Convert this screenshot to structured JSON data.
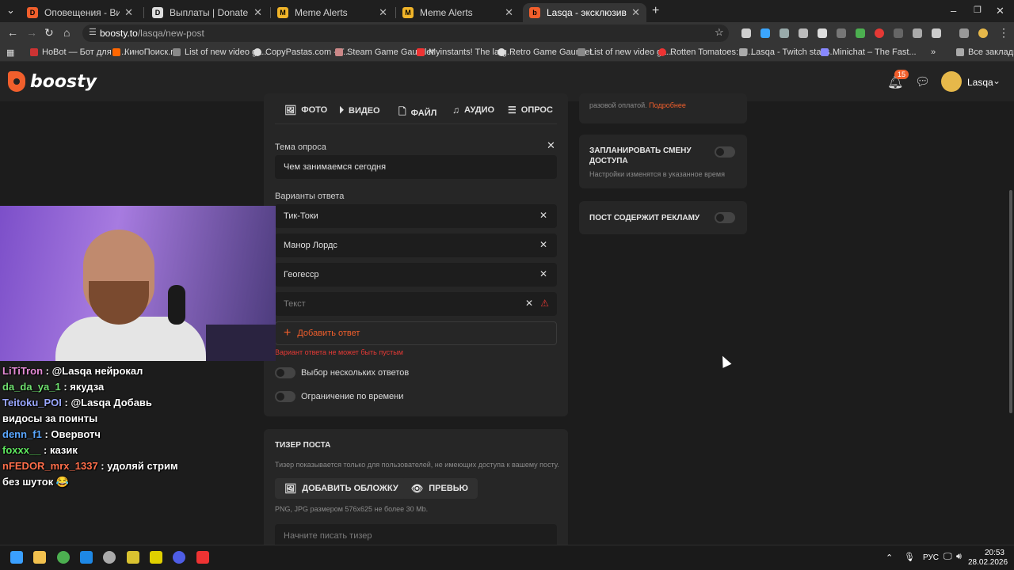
{
  "browser": {
    "tabs": [
      {
        "title": "Оповещения - Виджеты - Dona",
        "icon": "D",
        "color": "#f15f2c"
      },
      {
        "title": "Выплаты | DonatePay",
        "icon": "D",
        "color": "#111111"
      },
      {
        "title": "Meme Alerts",
        "icon": "M",
        "color": "#f0b429"
      },
      {
        "title": "Meme Alerts",
        "icon": "M",
        "color": "#f0b429"
      },
      {
        "title": "Lasqa - эксклюзивный контен",
        "icon": "b",
        "color": "#f15f2c"
      }
    ],
    "url_host": "boosty.to",
    "url_path": "/lasqa/new-post",
    "bookmarks": [
      "HoBot — Бот для V...",
      "КиноПоиск.ru",
      "List of new video ga...",
      "CopyPastas.com - T...",
      "Steam Game Gauntlet",
      "Myinstants! The larg...",
      "Retro Game Gauntlet",
      "List of new video ga...",
      "Rotten Tomatoes: M...",
      "Lasqa - Twitch statis...",
      "Minichat – The Fast..."
    ],
    "all_bookmarks": "Все закладки"
  },
  "site": {
    "logo": "boosty",
    "notifications": "15",
    "user": "Lasqa"
  },
  "editor": {
    "media_tabs": [
      {
        "label": "ФОТО",
        "icon": "image-icon"
      },
      {
        "label": "ВИДЕО",
        "icon": "play-icon"
      },
      {
        "label": "ФАЙЛ",
        "icon": "file-icon"
      },
      {
        "label": "АУДИО",
        "icon": "music-icon"
      },
      {
        "label": "ОПРОС",
        "icon": "list-icon"
      }
    ],
    "poll": {
      "topic_label": "Тема опроса",
      "topic_value": "Чем занимаемся сегодня",
      "answers_label": "Варианты ответа",
      "answers": [
        "Тик-Токи",
        "Манор Лордс",
        "Геогесср"
      ],
      "answer_placeholder": "Текст",
      "add_answer": "Добавить ответ",
      "error": "Вариант ответа не может быть пустым",
      "multiple_label": "Выбор нескольких ответов",
      "time_limit_label": "Ограничение по времени"
    },
    "teaser": {
      "title": "ТИЗЕР ПОСТА",
      "desc": "Тизер показывается только для пользователей, не имеющих доступа к вашему посту.",
      "add_cover": "ДОБАВИТЬ ОБЛОЖКУ",
      "preview": "ПРЕВЬЮ",
      "hint": "PNG, JPG размером 576x625 не более 30 Mb.",
      "placeholder": "Начните писать тизер"
    }
  },
  "sidebar": {
    "top_text": "разовой оплатой.",
    "top_link": "Подробнее",
    "schedule_title": "ЗАПЛАНИРОВАТЬ СМЕНУ ДОСТУПА",
    "schedule_desc": "Настройки изменятся в указанное время",
    "ads_title": "ПОСТ СОДЕРЖИТ РЕКЛАМУ"
  },
  "stream_chat": [
    {
      "user": "LiTiTron",
      "color": "#e58bd6",
      "msg": "@Lasqa нейрокал",
      "mention": "#e58bd6"
    },
    {
      "user": "da_da_ya_1",
      "color": "#6fe06f",
      "msg": "якудза"
    },
    {
      "user": "Teitoku_POI",
      "color": "#9aa7ff",
      "msg": "@Lasqa Добавь",
      "mention": "#e58bd6"
    },
    {
      "user": "",
      "color": "#ffffff",
      "msg": "видосы за поинты"
    },
    {
      "user": "denn_f1",
      "color": "#5aa7ff",
      "msg": "Овервотч"
    },
    {
      "user": "foxxx__",
      "color": "#5ee85e",
      "msg": "казик"
    },
    {
      "user": "nFEDOR_mrx_1337",
      "color": "#ff6e4a",
      "msg": "удоляй стрим"
    },
    {
      "user": "",
      "color": "#ffffff",
      "msg": "без шуток 😂"
    }
  ],
  "taskbar": {
    "lang": "РУС",
    "time": "20:53",
    "date": "28.02.2026"
  }
}
